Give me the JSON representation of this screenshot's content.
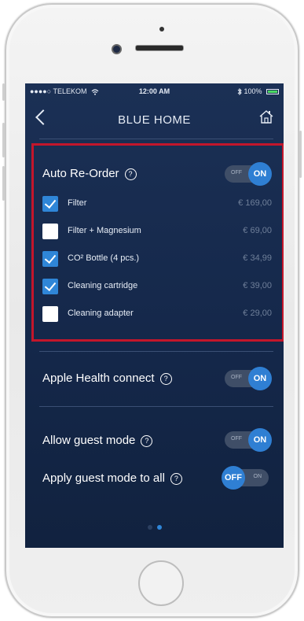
{
  "status_bar": {
    "carrier": "●●●●○ TELEKOM",
    "time": "12:00 AM",
    "battery": "100%"
  },
  "nav": {
    "title": "BLUE HOME"
  },
  "auto_reorder": {
    "title": "Auto Re-Order",
    "help": "?",
    "toggle": {
      "off": "OFF",
      "on": "ON",
      "state": "on"
    },
    "items": [
      {
        "label": "Filter",
        "price": "€ 169,00",
        "checked": true
      },
      {
        "label": "Filter + Magnesium",
        "price": "€ 69,00",
        "checked": false
      },
      {
        "label": "CO² Bottle (4 pcs.)",
        "price": "€ 34,99",
        "checked": true
      },
      {
        "label": "Cleaning cartridge",
        "price": "€ 39,00",
        "checked": true
      },
      {
        "label": "Cleaning adapter",
        "price": "€ 29,00",
        "checked": false
      }
    ]
  },
  "apple_health": {
    "title": "Apple Health connect",
    "help": "?",
    "toggle": {
      "off": "OFF",
      "on": "ON",
      "state": "on"
    }
  },
  "guest_mode": {
    "title": "Allow guest mode",
    "help": "?",
    "toggle": {
      "off": "OFF",
      "on": "ON",
      "state": "on"
    }
  },
  "guest_mode_all": {
    "title": "Apply guest mode to all",
    "help": "?",
    "toggle": {
      "off": "OFF",
      "on": "ON",
      "state": "off"
    }
  },
  "pagination": {
    "page": 2,
    "total": 2
  },
  "colors": {
    "accent": "#2f7fd3",
    "highlight_border": "#c3162b",
    "background": "#1b3055"
  }
}
